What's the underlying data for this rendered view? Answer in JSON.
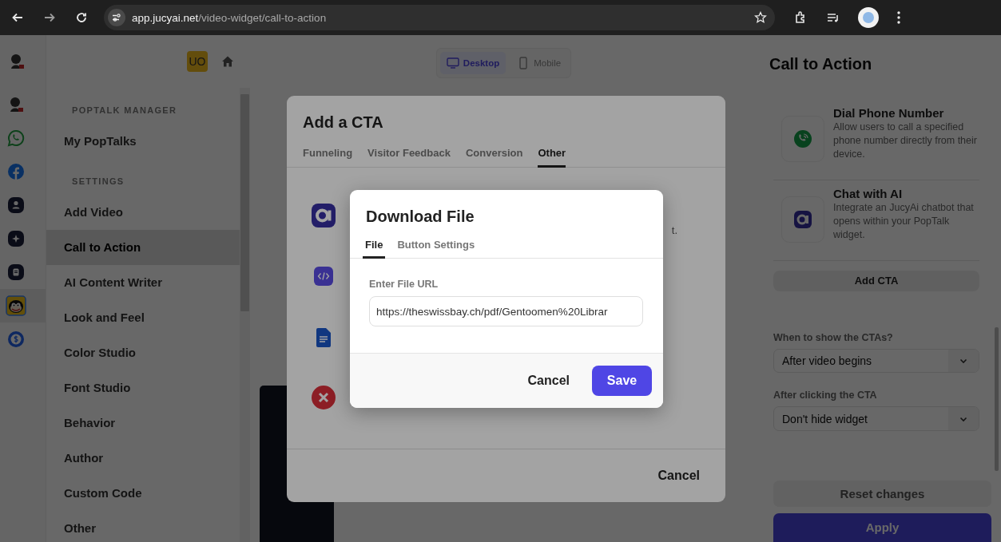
{
  "browser": {
    "url_host": "app.jucyai.net",
    "url_path": "/video-widget/call-to-action"
  },
  "header": {
    "badge": "UO"
  },
  "rail": [
    {
      "kind": "mascot",
      "selected": false
    },
    {
      "kind": "whatsapp",
      "selected": false
    },
    {
      "kind": "facebook",
      "selected": false
    },
    {
      "kind": "user",
      "selected": false
    },
    {
      "kind": "sparkle",
      "selected": false
    },
    {
      "kind": "document",
      "selected": false
    },
    {
      "kind": "cartoon",
      "selected": true
    },
    {
      "kind": "dollar",
      "selected": false
    }
  ],
  "sidebar": {
    "sections": [
      {
        "heading": "POPTALK MANAGER",
        "items": [
          {
            "label": "My PopTalks",
            "selected": false
          }
        ]
      },
      {
        "heading": "SETTINGS",
        "items": [
          {
            "label": "Add Video",
            "selected": false
          },
          {
            "label": "Call to Action",
            "selected": true
          },
          {
            "label": "AI Content Writer",
            "selected": false
          },
          {
            "label": "Look and Feel",
            "selected": false
          },
          {
            "label": "Color Studio",
            "selected": false
          },
          {
            "label": "Font Studio",
            "selected": false
          },
          {
            "label": "Behavior",
            "selected": false
          },
          {
            "label": "Author",
            "selected": false
          },
          {
            "label": "Custom Code",
            "selected": false
          },
          {
            "label": "Other",
            "selected": false
          }
        ]
      }
    ]
  },
  "preview_toggle": [
    {
      "kind": "desktop",
      "label": "Desktop",
      "selected": true
    },
    {
      "kind": "mobile",
      "label": "Mobile",
      "selected": false
    }
  ],
  "right_panel": {
    "title": "Call to Action",
    "cta_cards": [
      {
        "kind": "phone",
        "title": "Dial Phone Number",
        "description": "Allow users to call a specified phone number directly from their device."
      },
      {
        "kind": "chat-ai",
        "title": "Chat with AI",
        "description": "Integrate an JucyAi chatbot that opens within your PopTalk widget."
      }
    ],
    "add_button": "Add CTA",
    "fields": [
      {
        "label": "When to show the CTAs?",
        "value": "After video begins"
      },
      {
        "label": "After clicking the CTA",
        "value": "Don't hide widget"
      }
    ],
    "reset_button": "Reset changes",
    "apply_button": "Apply"
  },
  "add_cta_dialog": {
    "title": "Add a CTA",
    "tabs": [
      {
        "label": "Funneling",
        "selected": false
      },
      {
        "label": "Visitor Feedback",
        "selected": false
      },
      {
        "label": "Conversion",
        "selected": false
      },
      {
        "label": "Other",
        "selected": true
      }
    ],
    "options": [
      {
        "kind": "chat-ai",
        "description": "t."
      },
      {
        "kind": "code"
      },
      {
        "kind": "document"
      },
      {
        "kind": "remove"
      }
    ],
    "cancel_button": "Cancel"
  },
  "download_dialog": {
    "title": "Download File",
    "tabs": [
      {
        "label": "File",
        "selected": true
      },
      {
        "label": "Button Settings",
        "selected": false
      }
    ],
    "url_field": {
      "label": "Enter File URL",
      "value": "https://theswissbay.ch/pdf/Gentoomen%20Librar"
    },
    "cancel_button": "Cancel",
    "save_button": "Save"
  }
}
